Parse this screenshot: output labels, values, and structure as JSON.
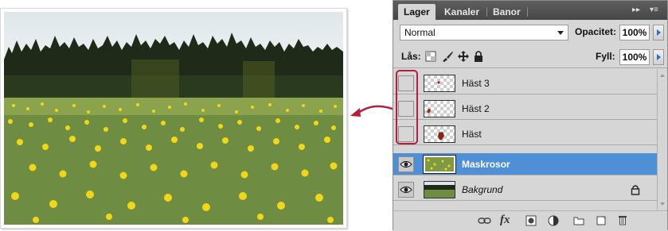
{
  "panel": {
    "tabs": [
      {
        "label": "Lager",
        "active": true
      },
      {
        "label": "Kanaler",
        "active": false
      },
      {
        "label": "Banor",
        "active": false
      }
    ],
    "blend_mode": "Normal",
    "opacity_label": "Opacitet:",
    "opacity_value": "100%",
    "lock_label": "Lås:",
    "fill_label": "Fyll:",
    "fill_value": "100%",
    "layers": [
      {
        "name": "Häst 3",
        "visible": false,
        "selected": false
      },
      {
        "name": "Häst 2",
        "visible": false,
        "selected": false
      },
      {
        "name": "Häst",
        "visible": false,
        "selected": false
      },
      {
        "name": "Maskrosor",
        "visible": true,
        "selected": true
      },
      {
        "name": "Bakgrund",
        "visible": true,
        "selected": false,
        "locked": true
      }
    ],
    "bottom_icons": [
      "link-icon",
      "fx-icon",
      "mask-icon",
      "adjustment-icon",
      "folder-icon",
      "new-layer-icon",
      "trash-icon"
    ],
    "bottom_fx_text": "fx",
    "highlight_color": "#b2203b",
    "selection_color": "#4f8fd5"
  },
  "photo": {
    "description_icon": "dandelion-field-photo"
  }
}
